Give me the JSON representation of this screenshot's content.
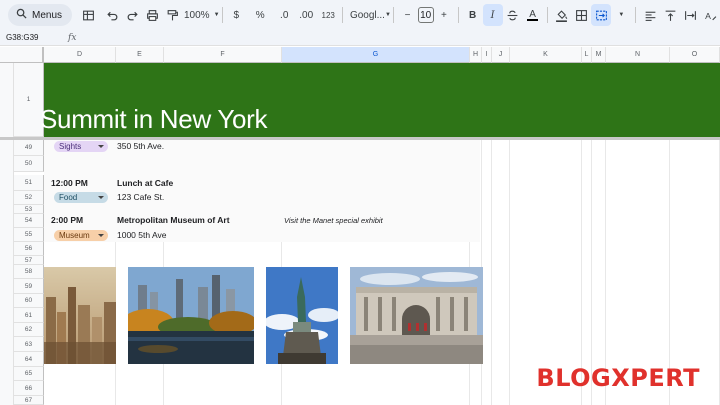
{
  "toolbar": {
    "menus_label": "Menus",
    "zoom": "100%",
    "currency": "$",
    "percent": "%",
    "decrease_decimal": ".0",
    "increase_decimal": ".00",
    "number_format": "123",
    "font_name": "Googl...",
    "font_size": "10",
    "minus": "−",
    "plus": "+",
    "bold": "B",
    "italic": "I",
    "text_color": "A"
  },
  "formula_bar": {
    "name_box": "G38:G39",
    "fx": "fx",
    "value": ""
  },
  "columns": [
    {
      "label": "D",
      "selected": false
    },
    {
      "label": "E",
      "selected": false
    },
    {
      "label": "F",
      "selected": false
    },
    {
      "label": "G",
      "selected": true
    },
    {
      "label": "H",
      "selected": false
    },
    {
      "label": "I",
      "selected": false
    },
    {
      "label": "J",
      "selected": false
    },
    {
      "label": "K",
      "selected": false
    },
    {
      "label": "L",
      "selected": false
    },
    {
      "label": "M",
      "selected": false
    },
    {
      "label": "N",
      "selected": false
    },
    {
      "label": "O",
      "selected": false
    }
  ],
  "rows": [
    "1",
    "49",
    "50",
    "51",
    "52",
    "53",
    "54",
    "55",
    "56",
    "57",
    "58",
    "59",
    "60",
    "61",
    "62",
    "63",
    "64",
    "65",
    "66",
    "67"
  ],
  "banner": {
    "title": "Summit in New York",
    "color": "#2e7417"
  },
  "itinerary": {
    "row49": {
      "chip": "Sights",
      "place": "350 5th Ave."
    },
    "row51": {
      "time": "12:00 PM",
      "title": "Lunch at Cafe"
    },
    "row52": {
      "chip": "Food",
      "place": "123 Cafe St."
    },
    "row54": {
      "time": "2:00 PM",
      "title": "Metropolitan Museum of Art",
      "note": "Visit the Manet special exhibit"
    },
    "row55": {
      "chip": "Museum",
      "place": "1000 5th Ave"
    }
  },
  "images": [
    {
      "name": "city-skyline-photo"
    },
    {
      "name": "central-park-photo"
    },
    {
      "name": "statue-of-liberty-photo"
    },
    {
      "name": "metropolitan-museum-photo"
    }
  ],
  "watermark": "BLOGXPERT",
  "colors": {
    "sights_chip": "#e4d5f5",
    "food_chip": "#c6dbe6",
    "museum_chip": "#f7cfa8",
    "selection": "#d3e3fd"
  }
}
